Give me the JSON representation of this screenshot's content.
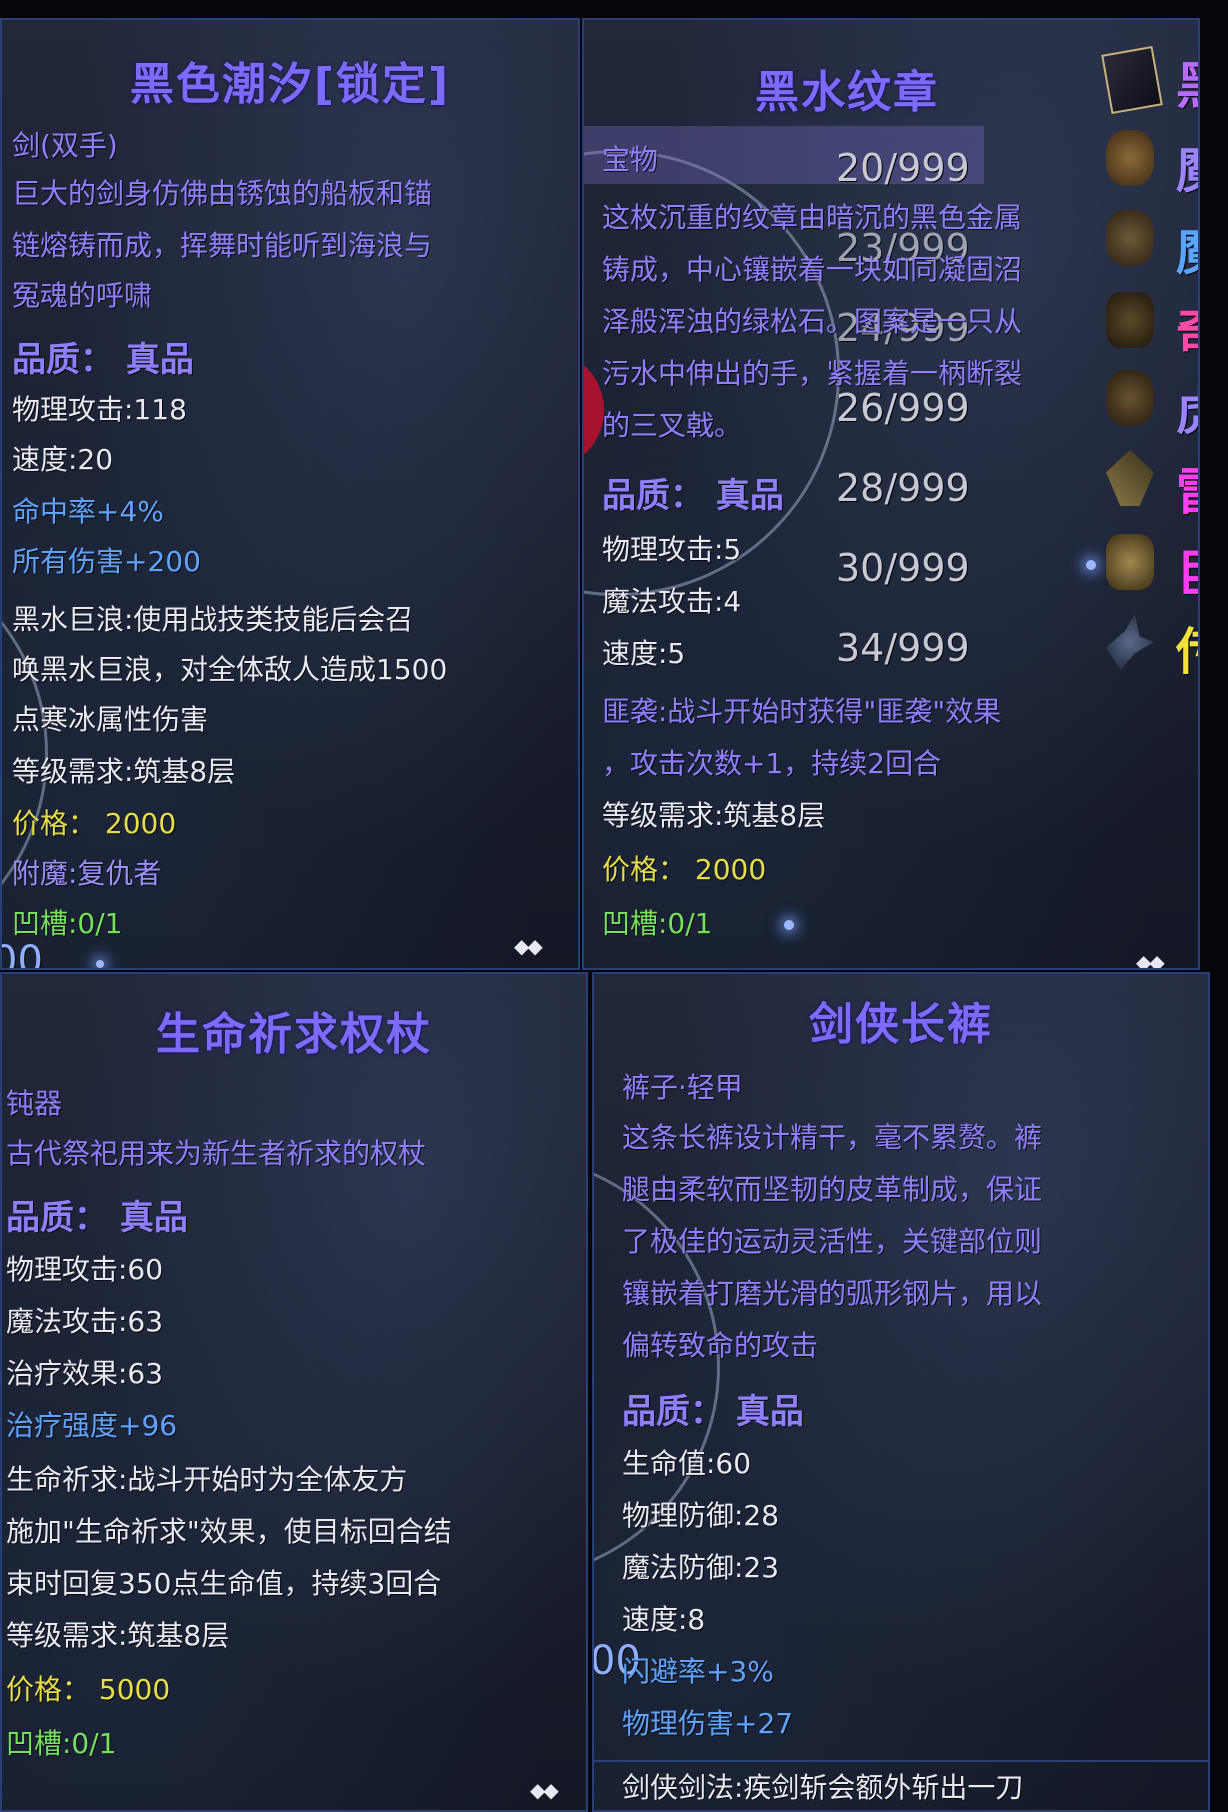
{
  "panel1": {
    "title": "黑色潮汐[锁定]",
    "type": "剑(双手)",
    "desc": [
      "巨大的剑身仿佛由锈蚀的船板和锚",
      "链熔铸而成，挥舞时能听到海浪与",
      "冤魂的呼啸"
    ],
    "quality": "品质：  真品",
    "stats": [
      "物理攻击:118",
      "速度:20"
    ],
    "bonuses": [
      "命中率+4%",
      "所有伤害+200"
    ],
    "skill": [
      "黑水巨浪:使用战技类技能后会召",
      "唤黑水巨浪，对全体敌人造成1500",
      "点寒冰属性伤害"
    ],
    "level": "等级需求:筑基8层",
    "price": "价格：  2000",
    "enchant": "附魔:复仇者",
    "slot": "凹槽:0/1",
    "corner_left": "00"
  },
  "panel2": {
    "title": "黑水纹章",
    "type": "宝物",
    "desc": [
      "这枚沉重的纹章由暗沉的黑色金属",
      "铸成，中心镶嵌着一块如同凝固沼",
      "泽般浑浊的绿松石。图案是一只从",
      "污水中伸出的手，紧握着一柄断裂",
      "的三叉戟。"
    ],
    "quality": "品质：  真品",
    "stats": [
      "物理攻击:5",
      "魔法攻击:4",
      "速度:5"
    ],
    "skill": [
      "匪袭:战斗开始时获得\"匪袭\"效果",
      "，攻击次数+1，持续2回合"
    ],
    "level": "等级需求:筑基8层",
    "price": "价格：  2000",
    "slot": "凹槽:0/1",
    "counts": [
      "20/999",
      "23/999",
      "24/999",
      "26/999",
      "28/999",
      "30/999",
      "34/999"
    ],
    "side_chars": [
      {
        "text": "黑",
        "color": "#b76cff"
      },
      {
        "text": "魔",
        "color": "#9a84ff"
      },
      {
        "text": "魔",
        "color": "#58a6ff"
      },
      {
        "text": "奇",
        "color": "#ff4aa8"
      },
      {
        "text": "虎",
        "color": "#9a84ff"
      },
      {
        "text": "雷",
        "color": "#ff3df2"
      },
      {
        "text": "巨",
        "color": "#ff3df2"
      },
      {
        "text": "传",
        "color": "#f0e23a"
      }
    ]
  },
  "panel3": {
    "title": "生命祈求权杖",
    "type": "钝器",
    "desc": [
      "古代祭祀用来为新生者祈求的权杖"
    ],
    "quality": "品质：  真品",
    "stats": [
      "物理攻击:60",
      "魔法攻击:63",
      "治疗效果:63"
    ],
    "bonuses": [
      "治疗强度+96"
    ],
    "skill": [
      "生命祈求:战斗开始时为全体友方",
      "施加\"生命祈求\"效果，使目标回合结",
      "束时回复350点生命值，持续3回合"
    ],
    "level": "等级需求:筑基8层",
    "price": "价格：  5000",
    "slot": "凹槽:0/1"
  },
  "panel4": {
    "title": "剑侠长裤",
    "type": "裤子·轻甲",
    "desc": [
      "这条长裤设计精干，毫不累赘。裤",
      "腿由柔软而坚韧的皮革制成，保证",
      "了极佳的运动灵活性，关键部位则",
      "镶嵌着打磨光滑的弧形钢片，用以",
      "偏转致命的攻击"
    ],
    "quality": "品质：  真品",
    "stats": [
      "生命值:60",
      "物理防御:28",
      "魔法防御:23",
      "速度:8"
    ],
    "bonuses": [
      "闪避率+3%",
      "物理伤害+27"
    ],
    "skill": [
      "剑侠剑法:疾剑斩会额外斩出一刀"
    ],
    "corner_left": "00"
  },
  "diamond_glyph": "◆◆",
  "colors": {
    "title": "#7b6cff",
    "text_purple": "#8f80ff",
    "stat_white": "#e9e9f2",
    "bonus_blue": "#5fa4ff",
    "price_yellow": "#e6dd47",
    "slot_green": "#76e05c",
    "border": "#2b3f77"
  }
}
